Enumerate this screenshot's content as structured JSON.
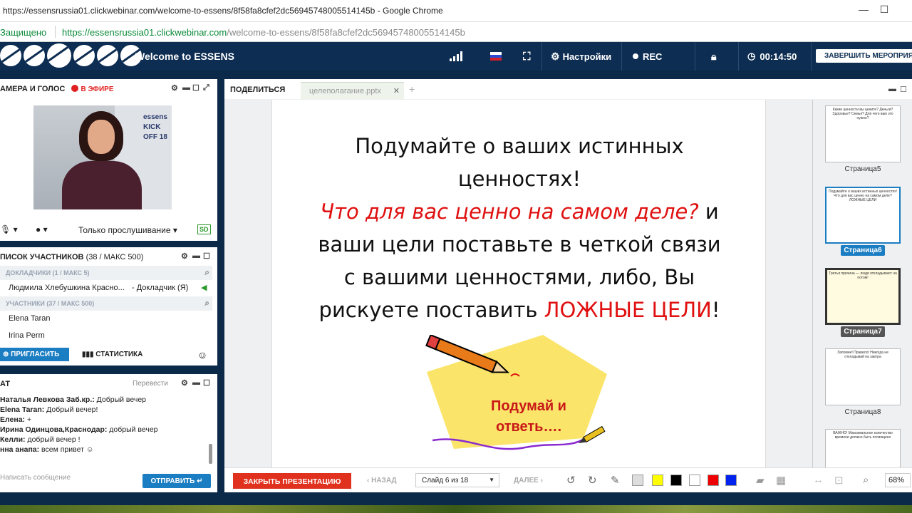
{
  "browser": {
    "title": "https://essensrussia01.clickwebinar.com/welcome-to-essens/8f58fa8cfef2dc56945748005514145b - Google Chrome",
    "secure_label": "Защищено",
    "url_host": "https://essensrussia01.clickwebinar.com",
    "url_path": "/welcome-to-essens/8f58fa8cfef2dc56945748005514145b",
    "minimize": "—",
    "maximize": "☐"
  },
  "appbar": {
    "title": "Welcome to ESSENS",
    "settings_label": "Настройки",
    "rec_label": "REC",
    "timer": "00:14:50",
    "end_button": "ЗАВЕРШИТЬ МЕРОПРИЯТИ"
  },
  "camera": {
    "title": "АМЕРА И ГОЛОС",
    "on_air": "В ЭФИРЕ",
    "listen_mode": "Только прослушивание",
    "sd_badge": "SD",
    "backdrop_text": "essens KICK OFF 18"
  },
  "participants": {
    "title": "ПИСОК УЧАСТНИКОВ",
    "count": "(38 / МАКС 500)",
    "speakers_header": "ДОКЛАДЧИКИ (1 / МАКС 5)",
    "speaker_name": "Людмила Хлебушкина Красно...",
    "speaker_role": "- Докладчик (Я)",
    "members_header": "УЧАСТНИКИ (37 / МАКС 500)",
    "members": [
      "Elena Taran",
      "Irina Perm"
    ],
    "invite_label": "ПРИГЛАСИТЬ",
    "stats_label": "СТАТИСТИКА"
  },
  "chat": {
    "title": "АТ",
    "translate_label": "Перевести",
    "messages": [
      {
        "author": "Наталья Левкова Заб.кр.:",
        "text": " Добрый вечер"
      },
      {
        "author": "Elena Taran:",
        "text": " Добрый вечер!"
      },
      {
        "author": "Елена:",
        "text": " +"
      },
      {
        "author": "Ирина Одинцова,Краснодар:",
        "text": " добрый вечер"
      },
      {
        "author": "Келли:",
        "text": " добрый вечер !"
      },
      {
        "author": "нна анапа:",
        "text": " всем привет"
      }
    ],
    "input_placeholder": "Написать сообщение",
    "send_label": "ОТПРАВИТЬ"
  },
  "share": {
    "title": "ПОДЕЛИТЬСЯ",
    "file_tab": "целеполагание.pptx",
    "slide": {
      "line1": "Подумайте о ваших истинных",
      "line2": "ценностях!",
      "line3_red": "Что для вас ценно на самом деле?",
      "line3_rest": " и",
      "line4": "ваши цели поставьте в четкой связи",
      "line5": "с вашими ценностями, либо, Вы",
      "line6_start": "рискуете поставить ",
      "line6_red": "ЛОЖНЫЕ ЦЕЛИ",
      "line6_end": "!",
      "art_text1": "Подумай и",
      "art_text2": "ответь…."
    },
    "thumbnails": [
      {
        "label": "Страница5",
        "text": "Какие ценности вы цените? Деньги? Здоровье? Семья? Для чего вам это нужно?"
      },
      {
        "label": "Страница6",
        "text": "Подумайте о ваших истинных ценностях! Что для вас ценно на самом деле? ЛОЖНЫЕ ЦЕЛИ"
      },
      {
        "label": "Страница7",
        "text": "Третья причина — люди откладывают на потом!"
      },
      {
        "label": "Страница8",
        "text": "Запомни! Правило! Никогда не откладывай на завтра"
      },
      {
        "label": "",
        "text": "ВАЖНО! Максимальное количество времени должно быть посвящено"
      }
    ],
    "toolbar": {
      "close_label": "ЗАКРЫТЬ ПРЕЗЕНТАЦИЮ",
      "back_label": "НАЗАД",
      "slide_selector": "Слайд 6 из 18",
      "next_label": "ДАЛЕЕ",
      "zoom": "68%"
    }
  },
  "colors": {
    "appbar": "#0d2d52",
    "accent_blue": "#1b7dc2",
    "red": "#e01010",
    "close_red": "#e0301e"
  }
}
